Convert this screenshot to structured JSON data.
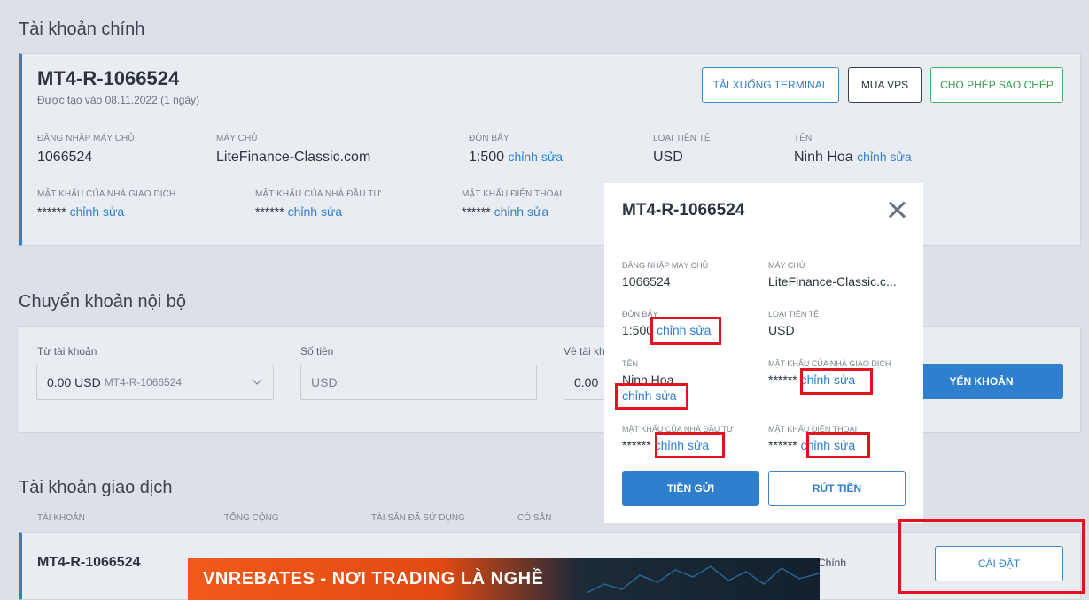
{
  "main_account": {
    "section_title": "Tài khoản chính",
    "account_id": "MT4-R-1066524",
    "created": "Được tạo vào 08.11.2022 (1 ngày)",
    "buttons": {
      "download": "TẢI XUỐNG TERMINAL",
      "vps": "MUA VPS",
      "copy": "CHO PHÉP SAO CHÉP"
    },
    "fields": {
      "server_login_label": "ĐĂNG NHẬP MÁY CHỦ",
      "server_login": "1066524",
      "server_label": "MÁY CHỦ",
      "server": "LiteFinance-Classic.com",
      "leverage_label": "ĐÒN BẨY",
      "leverage": "1:500",
      "currency_label": "LOẠI TIỀN TỆ",
      "currency": "USD",
      "name_label": "TÊN",
      "name": "Ninh Hoa",
      "trader_pw_label": "MẬT KHẨU CỦA NHÀ GIAO DỊCH",
      "investor_pw_label": "MẬT KHẨU CỦA NHÀ ĐẦU TƯ",
      "phone_pw_label": "MẬT KHẨU ĐIỆN THOẠI",
      "masked": "******",
      "edit": "chỉnh sửa"
    }
  },
  "transfer": {
    "section_title": "Chuyển khoản nội bộ",
    "from_label": "Từ tài khoản",
    "from_value": "0.00 USD",
    "from_account": "MT4-R-1066524",
    "amount_label": "Số tiền",
    "amount_placeholder": "USD",
    "to_label": "Về tài kh",
    "to_value": "0.00",
    "button": "YỂN KHOẢN"
  },
  "trading": {
    "section_title": "Tài khoản giao dịch",
    "headers": [
      "TÀI KHOẢN",
      "TỔNG CỘNG",
      "TÀI SẢN ĐÃ SỬ DỤNG",
      "CÓ SẴN"
    ],
    "row": {
      "account": "MT4-R-1066524",
      "type": "Chính",
      "settings_button": "CÀI ĐẶT"
    }
  },
  "banner": {
    "text": "VNREBATES - NƠI TRADING LÀ NGHỀ"
  },
  "modal": {
    "title": "MT4-R-1066524",
    "server_login_label": "ĐĂNG NHẬP MÁY CHỦ",
    "server_login": "1066524",
    "server_label": "MÁY CHỦ",
    "server": "LiteFinance-Classic.c...",
    "leverage_label": "ĐÒN BẨY",
    "leverage": "1:500",
    "currency_label": "LOẠI TIỀN TỆ",
    "currency": "USD",
    "name_label": "TÊN",
    "name": "Ninh Hoa",
    "trader_pw_label": "MẬT KHẨU CỦA NHÀ GIAO DỊCH",
    "investor_pw_label": "MẬT KHẨU CỦA NHÀ ĐẦU TƯ",
    "phone_pw_label": "MẬT KHẨU ĐIỆN THOẠI",
    "masked": "******",
    "edit": "chỉnh sửa",
    "deposit": "TIỀN GỬI",
    "withdraw": "RÚT TIỀN"
  },
  "colors": {
    "accent": "#2f7fcf",
    "green": "#43b55f",
    "highlight": "#e0141e",
    "background": "#dde1e7"
  }
}
